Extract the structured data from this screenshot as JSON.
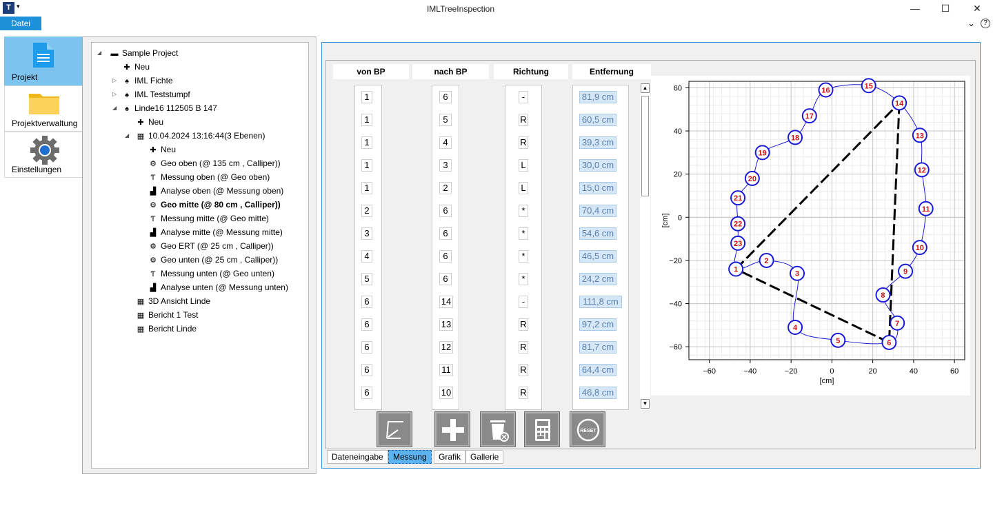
{
  "window": {
    "title": "IMLTreeInspection",
    "icon_text": "T",
    "qa_arrow": "▾",
    "minimize": "—",
    "maximize": "☐",
    "close": "✕"
  },
  "menu": {
    "file": "Datei",
    "collapse_icon": "⌄",
    "help": "?"
  },
  "nav": [
    {
      "label": "Projekt",
      "icon": "document-icon",
      "selected": true
    },
    {
      "label": "Projektverwaltung",
      "icon": "folder-icon",
      "selected": false
    },
    {
      "label": "Einstellungen",
      "icon": "gear-icon",
      "selected": false
    }
  ],
  "tree": [
    {
      "label": "Sample Project",
      "icon": "folder-icon",
      "level": 0,
      "expander": "◢",
      "bold": false
    },
    {
      "label": "Neu",
      "icon": "plus-icon",
      "level": 1,
      "expander": "",
      "bold": false
    },
    {
      "label": "IML Fichte",
      "icon": "tree-icon",
      "level": 1,
      "expander": "▷",
      "bold": false
    },
    {
      "label": "IML Teststumpf",
      "icon": "tree-icon",
      "level": 1,
      "expander": "▷",
      "bold": false
    },
    {
      "label": "Linde16 112505 B 147",
      "icon": "tree-icon",
      "level": 1,
      "expander": "◢",
      "bold": false
    },
    {
      "label": "Neu",
      "icon": "plus-icon",
      "level": 2,
      "expander": "",
      "bold": false
    },
    {
      "label": "10.04.2024 13:16:44(3 Ebenen)",
      "icon": "table-icon",
      "level": 2,
      "expander": "◢",
      "bold": false
    },
    {
      "label": "Neu",
      "icon": "plus-icon",
      "level": 3,
      "expander": "",
      "bold": false
    },
    {
      "label": "Geo oben (@ 135 cm , Calliper))",
      "icon": "geo-icon",
      "level": 3,
      "expander": "",
      "bold": false
    },
    {
      "label": "Messung oben (@ Geo oben)",
      "icon": "measure-icon",
      "level": 3,
      "expander": "",
      "bold": false
    },
    {
      "label": "Analyse oben (@ Messung oben)",
      "icon": "analysis-icon",
      "level": 3,
      "expander": "",
      "bold": false
    },
    {
      "label": "Geo mitte (@ 80 cm , Calliper))",
      "icon": "geo-icon",
      "level": 3,
      "expander": "",
      "bold": true
    },
    {
      "label": "Messung mitte (@ Geo mitte)",
      "icon": "measure-icon",
      "level": 3,
      "expander": "",
      "bold": false
    },
    {
      "label": "Analyse mitte (@ Messung mitte)",
      "icon": "analysis-icon",
      "level": 3,
      "expander": "",
      "bold": false
    },
    {
      "label": "Geo ERT (@ 25 cm , Calliper))",
      "icon": "geo-icon",
      "level": 3,
      "expander": "",
      "bold": false
    },
    {
      "label": "Geo unten (@ 25 cm , Calliper))",
      "icon": "geo-icon",
      "level": 3,
      "expander": "",
      "bold": false
    },
    {
      "label": "Messung unten (@ Geo unten)",
      "icon": "measure-icon",
      "level": 3,
      "expander": "",
      "bold": false
    },
    {
      "label": "Analyse unten (@ Messung unten)",
      "icon": "analysis-icon",
      "level": 3,
      "expander": "",
      "bold": false
    },
    {
      "label": "3D Ansicht Linde",
      "icon": "table-icon",
      "level": 2,
      "expander": "",
      "bold": false
    },
    {
      "label": "Bericht 1 Test",
      "icon": "table-icon",
      "level": 2,
      "expander": "",
      "bold": false
    },
    {
      "label": "Bericht Linde",
      "icon": "table-icon",
      "level": 2,
      "expander": "",
      "bold": false
    }
  ],
  "table": {
    "headers": [
      "von BP",
      "nach BP",
      "Richtung",
      "Entfernung"
    ],
    "rows": [
      [
        "1",
        "6",
        "-",
        "81,9 cm"
      ],
      [
        "1",
        "5",
        "R",
        "60,5 cm"
      ],
      [
        "1",
        "4",
        "R",
        "39,3 cm"
      ],
      [
        "1",
        "3",
        "L",
        "30,0 cm"
      ],
      [
        "1",
        "2",
        "L",
        "15,0 cm"
      ],
      [
        "2",
        "6",
        "*",
        "70,4 cm"
      ],
      [
        "3",
        "6",
        "*",
        "54,6 cm"
      ],
      [
        "4",
        "6",
        "*",
        "46,5 cm"
      ],
      [
        "5",
        "6",
        "*",
        "24,2 cm"
      ],
      [
        "6",
        "14",
        "-",
        "111,8 cm"
      ],
      [
        "6",
        "13",
        "R",
        "97,2 cm"
      ],
      [
        "6",
        "12",
        "R",
        "81,7 cm"
      ],
      [
        "6",
        "11",
        "R",
        "64,4 cm"
      ],
      [
        "6",
        "10",
        "R",
        "46,8 cm"
      ]
    ]
  },
  "toolbar": [
    "draw-icon",
    "add-icon",
    "delete-icon",
    "calculator-icon",
    "reset-icon"
  ],
  "toolbar_reset_text": "RESET",
  "tabs": [
    {
      "label": "Dateneingabe",
      "selected": false
    },
    {
      "label": "Messung",
      "selected": true
    },
    {
      "label": "Grafik",
      "selected": false
    },
    {
      "label": "Gallerie",
      "selected": false
    }
  ],
  "chart_data": {
    "type": "scatter",
    "xlabel": "[cm]",
    "ylabel": "[cm]",
    "xlim": [
      -70,
      65
    ],
    "ylim": [
      -66,
      63
    ],
    "xticks": [
      -60,
      -40,
      -20,
      0,
      20,
      40,
      60
    ],
    "yticks": [
      -60,
      -40,
      -20,
      0,
      20,
      40,
      60
    ],
    "grid": true,
    "points": [
      {
        "label": "1",
        "x": -47,
        "y": -24
      },
      {
        "label": "2",
        "x": -32,
        "y": -20
      },
      {
        "label": "3",
        "x": -17,
        "y": -26
      },
      {
        "label": "4",
        "x": -18,
        "y": -51
      },
      {
        "label": "5",
        "x": 3,
        "y": -57
      },
      {
        "label": "6",
        "x": 28,
        "y": -58
      },
      {
        "label": "7",
        "x": 32,
        "y": -49
      },
      {
        "label": "8",
        "x": 25,
        "y": -36
      },
      {
        "label": "9",
        "x": 36,
        "y": -25
      },
      {
        "label": "10",
        "x": 43,
        "y": -14
      },
      {
        "label": "11",
        "x": 46,
        "y": 4
      },
      {
        "label": "12",
        "x": 44,
        "y": 22
      },
      {
        "label": "13",
        "x": 43,
        "y": 38
      },
      {
        "label": "14",
        "x": 33,
        "y": 53
      },
      {
        "label": "15",
        "x": 18,
        "y": 61
      },
      {
        "label": "16",
        "x": -3,
        "y": 59
      },
      {
        "label": "17",
        "x": -11,
        "y": 47
      },
      {
        "label": "18",
        "x": -18,
        "y": 37
      },
      {
        "label": "19",
        "x": -34,
        "y": 30
      },
      {
        "label": "20",
        "x": -39,
        "y": 18
      },
      {
        "label": "21",
        "x": -46,
        "y": 9
      },
      {
        "label": "22",
        "x": -46,
        "y": -3
      },
      {
        "label": "23",
        "x": -46,
        "y": -12
      }
    ],
    "lines": [
      [
        "1",
        "14"
      ],
      [
        "14",
        "6"
      ],
      [
        "6",
        "1"
      ]
    ],
    "colors": {
      "marker_border": "#1a1ad6",
      "marker_text": "#cc1111",
      "line": "#000000",
      "outline": "#1a1ad6"
    }
  }
}
